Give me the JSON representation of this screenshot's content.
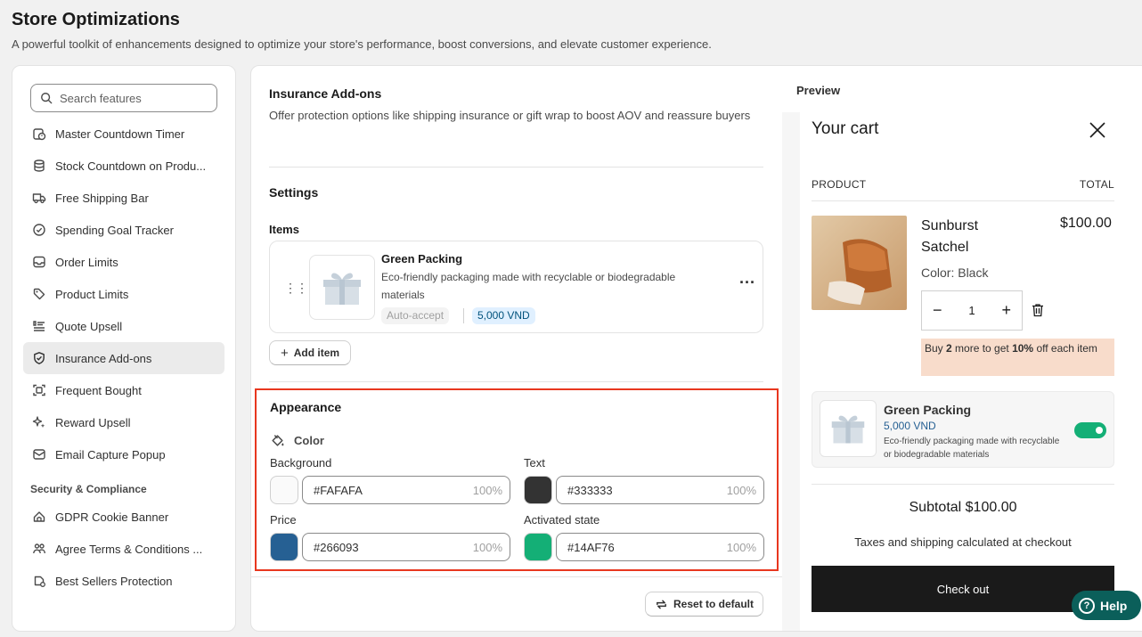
{
  "page": {
    "title": "Store Optimizations",
    "subtitle": "A powerful toolkit of enhancements designed to optimize your store's performance, boost conversions, and elevate customer experience."
  },
  "sidebar": {
    "search_placeholder": "Search features",
    "items": [
      {
        "label": "Master Countdown Timer",
        "icon": "timer-icon"
      },
      {
        "label": "Stock Countdown on Produ...",
        "icon": "stack-icon"
      },
      {
        "label": "Free Shipping Bar",
        "icon": "truck-icon"
      },
      {
        "label": "Spending Goal Tracker",
        "icon": "check-circle-icon"
      },
      {
        "label": "Order Limits",
        "icon": "inbox-icon"
      },
      {
        "label": "Product Limits",
        "icon": "tag-icon"
      },
      {
        "label": "Quote Upsell",
        "icon": "list-icon"
      },
      {
        "label": "Insurance Add-ons",
        "icon": "shield-icon"
      },
      {
        "label": "Frequent Bought",
        "icon": "scan-icon"
      },
      {
        "label": "Reward Upsell",
        "icon": "sparkle-icon"
      },
      {
        "label": "Email Capture Popup",
        "icon": "mail-icon"
      }
    ],
    "section_security": "Security & Compliance",
    "security_items": [
      {
        "label": "GDPR Cookie Banner",
        "icon": "cookie-icon"
      },
      {
        "label": "Agree Terms & Conditions ...",
        "icon": "people-icon"
      },
      {
        "label": "Best Sellers Protection",
        "icon": "protect-icon"
      }
    ]
  },
  "settings": {
    "title": "Insurance Add-ons",
    "description": "Offer protection options like shipping insurance or gift wrap to boost AOV and reassure buyers",
    "settings_heading": "Settings",
    "items_heading": "Items",
    "item": {
      "name": "Green Packing",
      "description": "Eco-friendly packaging made with recyclable or biodegradable materials",
      "badge_auto": "Auto-accept",
      "badge_price": "5,000 VND"
    },
    "add_item_label": "Add item",
    "reset_label": "Reset to default"
  },
  "appearance": {
    "title": "Appearance",
    "color_label": "Color",
    "fields": {
      "background": {
        "label": "Background",
        "value": "#FAFAFA",
        "opacity": "100%",
        "color": "#FAFAFA"
      },
      "text": {
        "label": "Text",
        "value": "#333333",
        "opacity": "100%",
        "color": "#333333"
      },
      "price": {
        "label": "Price",
        "value": "#266093",
        "opacity": "100%",
        "color": "#266093"
      },
      "activated": {
        "label": "Activated state",
        "value": "#14AF76",
        "opacity": "100%",
        "color": "#14AF76"
      }
    }
  },
  "preview": {
    "label": "Preview",
    "cart_title": "Your cart",
    "col_product": "PRODUCT",
    "col_total": "TOTAL",
    "product": {
      "name": "Sunburst Satchel",
      "price": "$100.00",
      "variant": "Color: Black",
      "quantity": "1"
    },
    "promo": {
      "pre": "Buy ",
      "qty": "2",
      "mid": " more to get ",
      "pct": "10%",
      "post": " off each item"
    },
    "addon": {
      "name": "Green Packing",
      "price": "5,000 VND",
      "description": "Eco-friendly packaging made with recyclable or biodegradable materials",
      "enabled": true
    },
    "subtotal": "Subtotal $100.00",
    "taxes": "Taxes and shipping calculated at checkout",
    "checkout": "Check out"
  },
  "help": {
    "label": "Help"
  }
}
